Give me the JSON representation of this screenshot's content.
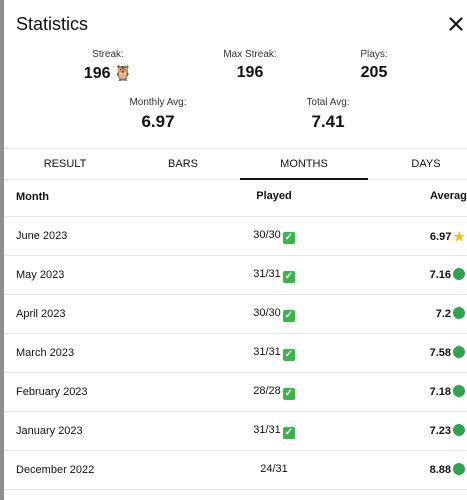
{
  "header": {
    "title": "Statistics",
    "close_icon": "close-icon"
  },
  "stats": {
    "streak": {
      "label": "Streak:",
      "value": "196",
      "icon": "owl-emoji"
    },
    "max_streak": {
      "label": "Max Streak:",
      "value": "196"
    },
    "plays": {
      "label": "Plays:",
      "value": "205"
    },
    "monthly_avg": {
      "label": "Monthly Avg:",
      "value": "6.97"
    },
    "total_avg": {
      "label": "Total Avg:",
      "value": "7.41"
    }
  },
  "tabs": [
    {
      "label": "RESULT"
    },
    {
      "label": "BARS"
    },
    {
      "label": "MONTHS",
      "active": true
    },
    {
      "label": "DAYS"
    }
  ],
  "table": {
    "headers": {
      "month": "Month",
      "played": "Played",
      "average": "Average"
    },
    "rows": [
      {
        "month": "June 2023",
        "played": "30/30",
        "played_icon": "check",
        "average": "6.97",
        "avg_icon": "star"
      },
      {
        "month": "May 2023",
        "played": "31/31",
        "played_icon": "check",
        "average": "7.16",
        "avg_icon": "green-dot"
      },
      {
        "month": "April 2023",
        "played": "30/30",
        "played_icon": "check",
        "average": "7.2",
        "avg_icon": "green-dot"
      },
      {
        "month": "March 2023",
        "played": "31/31",
        "played_icon": "check",
        "average": "7.58",
        "avg_icon": "green-dot"
      },
      {
        "month": "February 2023",
        "played": "28/28",
        "played_icon": "check",
        "average": "7.18",
        "avg_icon": "green-dot"
      },
      {
        "month": "January 2023",
        "played": "31/31",
        "played_icon": "check",
        "average": "7.23",
        "avg_icon": "green-dot"
      },
      {
        "month": "December 2022",
        "played": "24/31",
        "played_icon": "",
        "average": "8.88",
        "avg_icon": "green-dot"
      }
    ]
  },
  "colors": {
    "check": "#3bb44a",
    "dot": "#2ea44f",
    "star": "#f2c200"
  }
}
